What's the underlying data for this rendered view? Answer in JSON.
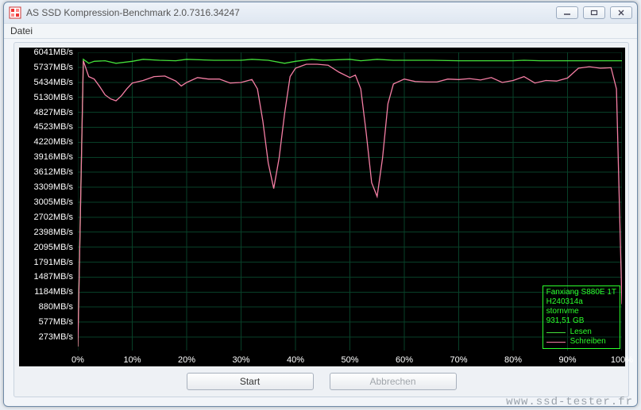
{
  "window": {
    "title": "AS SSD Kompression-Benchmark 2.0.7316.34247"
  },
  "menu": {
    "file": "Datei"
  },
  "buttons": {
    "start": "Start",
    "abort": "Abbrechen"
  },
  "device_info": {
    "name": "Fanxiang S880E 1T",
    "firmware": "H240314a",
    "driver": "stornvme",
    "capacity": "931,51 GB"
  },
  "legend": {
    "read": "Lesen",
    "write": "Schreiben"
  },
  "watermark": "www.ssd-tester.fr",
  "chart_data": {
    "type": "line",
    "xlabel": "",
    "ylabel": "",
    "x_unit": "%",
    "y_unit": "MB/s",
    "xlim": [
      0,
      100
    ],
    "ylim": [
      0,
      6041
    ],
    "y_ticks": [
      273,
      577,
      880,
      1184,
      1487,
      1791,
      2095,
      2398,
      2702,
      3005,
      3309,
      3612,
      3916,
      4220,
      4523,
      4827,
      5130,
      5434,
      5737,
      6041
    ],
    "y_tick_labels": [
      "273MB/s",
      "577MB/s",
      "880MB/s",
      "1184MB/s",
      "1487MB/s",
      "1791MB/s",
      "2095MB/s",
      "2398MB/s",
      "2702MB/s",
      "3005MB/s",
      "3309MB/s",
      "3612MB/s",
      "3916MB/s",
      "4220MB/s",
      "4523MB/s",
      "4827MB/s",
      "5130MB/s",
      "5434MB/s",
      "5737MB/s",
      "6041MB/s"
    ],
    "x_ticks": [
      0,
      10,
      20,
      30,
      40,
      50,
      60,
      70,
      80,
      90,
      100
    ],
    "x_tick_labels": [
      "0%",
      "10%",
      "20%",
      "30%",
      "40%",
      "50%",
      "60%",
      "70%",
      "80%",
      "90%",
      "100%"
    ],
    "series": [
      {
        "name": "Lesen",
        "color": "#43e03b",
        "x": [
          0,
          1,
          2,
          3,
          5,
          7,
          10,
          12,
          15,
          18,
          20,
          25,
          30,
          32,
          35,
          38,
          40,
          43,
          45,
          50,
          52,
          55,
          58,
          60,
          65,
          70,
          75,
          80,
          82,
          85,
          88,
          90,
          95,
          100
        ],
        "y": [
          80,
          5900,
          5820,
          5860,
          5870,
          5820,
          5860,
          5900,
          5880,
          5870,
          5900,
          5880,
          5880,
          5900,
          5880,
          5820,
          5860,
          5900,
          5880,
          5900,
          5870,
          5900,
          5880,
          5880,
          5880,
          5870,
          5870,
          5870,
          5880,
          5870,
          5870,
          5870,
          5870,
          5870
        ]
      },
      {
        "name": "Schreiben",
        "color": "#f57ea4",
        "x": [
          0,
          1,
          2,
          3,
          4,
          5,
          6,
          7,
          8,
          9,
          10,
          12,
          14,
          16,
          18,
          19,
          20,
          22,
          24,
          26,
          28,
          30,
          32,
          33,
          34,
          35,
          36,
          37,
          38,
          39,
          40,
          42,
          44,
          46,
          48,
          50,
          51,
          52,
          53,
          54,
          55,
          56,
          57,
          58,
          60,
          62,
          64,
          66,
          68,
          70,
          72,
          74,
          76,
          78,
          80,
          82,
          84,
          86,
          88,
          90,
          92,
          94,
          96,
          98,
          99,
          100
        ],
        "y": [
          80,
          5870,
          5550,
          5500,
          5350,
          5180,
          5100,
          5060,
          5160,
          5300,
          5420,
          5470,
          5550,
          5560,
          5460,
          5360,
          5430,
          5530,
          5500,
          5500,
          5420,
          5430,
          5490,
          5300,
          4650,
          3800,
          3280,
          3900,
          4800,
          5550,
          5720,
          5800,
          5800,
          5780,
          5640,
          5530,
          5580,
          5300,
          4400,
          3400,
          3120,
          3900,
          5000,
          5400,
          5500,
          5450,
          5440,
          5440,
          5500,
          5490,
          5510,
          5480,
          5530,
          5430,
          5470,
          5550,
          5420,
          5470,
          5460,
          5520,
          5720,
          5750,
          5720,
          5730,
          5300,
          940
        ]
      }
    ]
  }
}
